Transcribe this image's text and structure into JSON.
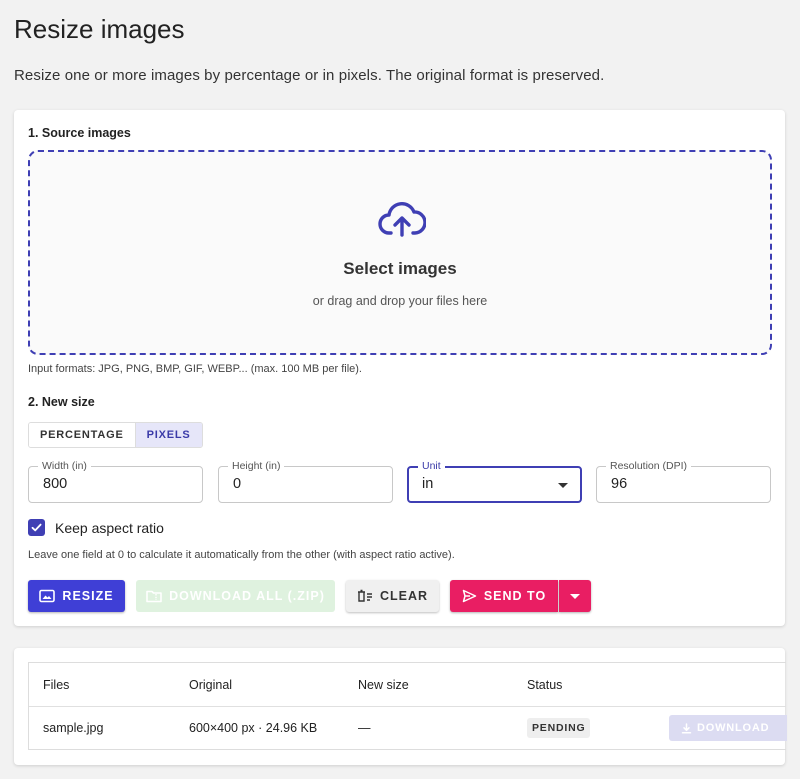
{
  "page": {
    "title": "Resize images",
    "subtitle": "Resize one or more images by percentage or in pixels. The original format is preserved."
  },
  "source": {
    "section_label": "1. Source images",
    "dropzone_title": "Select images",
    "dropzone_subtitle": "or drag and drop your files here",
    "formats_note": "Input formats: JPG, PNG, BMP, GIF, WEBP... (max. 100 MB per file)."
  },
  "new_size": {
    "section_label": "2. New size",
    "modes": [
      {
        "label": "PERCENTAGE",
        "active": false
      },
      {
        "label": "PIXELS",
        "active": true
      }
    ],
    "fields": {
      "width": {
        "label": "Width (in)",
        "value": "800"
      },
      "height": {
        "label": "Height (in)",
        "value": "0"
      },
      "unit": {
        "label": "Unit",
        "value": "in"
      },
      "resolution": {
        "label": "Resolution (DPI)",
        "value": "96"
      }
    },
    "keep_aspect": {
      "label": "Keep aspect ratio",
      "checked": true
    },
    "hint": "Leave one field at 0 to calculate it automatically from the other (with aspect ratio active)."
  },
  "actions": {
    "resize": "RESIZE",
    "download_all": "DOWNLOAD ALL (.ZIP)",
    "clear": "CLEAR",
    "send_to": "SEND TO"
  },
  "files_table": {
    "headers": [
      "Files",
      "Original",
      "New size",
      "Status"
    ],
    "rows": [
      {
        "file": "sample.jpg",
        "original": "600×400 px · 24.96 KB",
        "new_size": "—",
        "status": "PENDING",
        "download": "DOWNLOAD"
      }
    ]
  },
  "colors": {
    "accent": "#3f3fd6",
    "pink": "#e91e63",
    "dropzone_border": "#3f3fb4"
  }
}
